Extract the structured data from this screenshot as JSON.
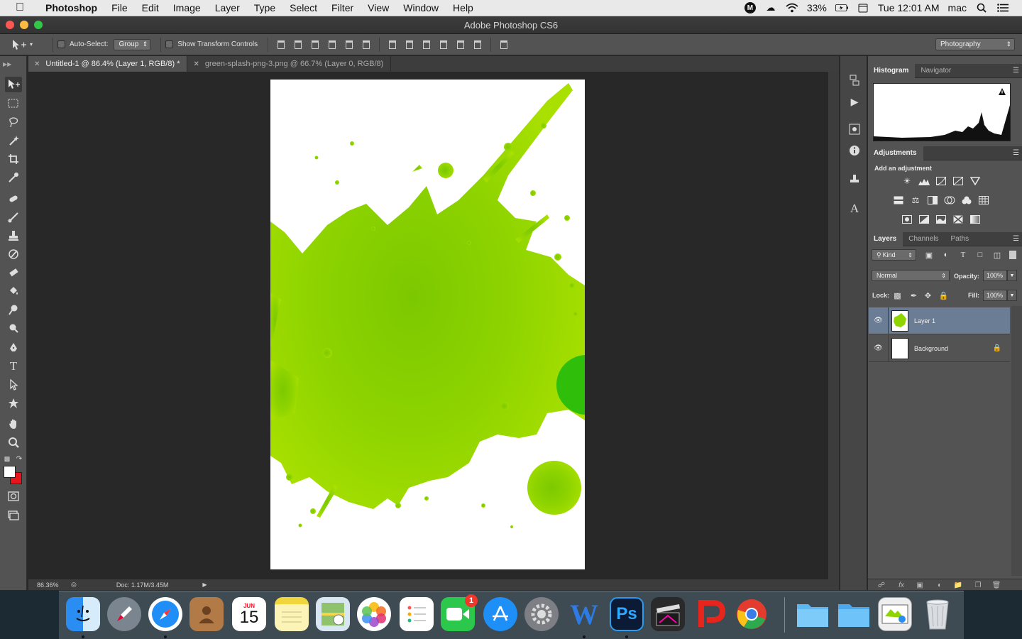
{
  "menubar": {
    "app_name": "Photoshop",
    "items": [
      "File",
      "Edit",
      "Image",
      "Layer",
      "Type",
      "Select",
      "Filter",
      "View",
      "Window",
      "Help"
    ],
    "status_m": "M",
    "battery": "33%",
    "clock": "Tue 12:01 AM",
    "user": "mac"
  },
  "window": {
    "title": "Adobe Photoshop CS6"
  },
  "options": {
    "auto_select_label": "Auto-Select:",
    "auto_select_value": "Group",
    "transform_label": "Show Transform Controls",
    "workspace": "Photography"
  },
  "tabs": [
    {
      "label": "Untitled-1 @ 86.4% (Layer 1, RGB/8) *"
    },
    {
      "label": "green-splash-png-3.png @ 66.7% (Layer 0, RGB/8)"
    }
  ],
  "status": {
    "zoom": "86.36%",
    "doc": "Doc: 1.17M/3.45M"
  },
  "panels": {
    "histogram_tabs": [
      "Histogram",
      "Navigator"
    ],
    "adjustments_tab": "Adjustments",
    "adjustments_title": "Add an adjustment",
    "layers_tabs": [
      "Layers",
      "Channels",
      "Paths"
    ],
    "kind": "Kind",
    "blend_mode": "Normal",
    "opacity_label": "Opacity:",
    "opacity": "100%",
    "lock_label": "Lock:",
    "fill_label": "Fill:",
    "fill": "100%",
    "layers": [
      {
        "name": "Layer 1"
      },
      {
        "name": "Background"
      }
    ]
  },
  "dock": {
    "calendar_month": "JUN",
    "calendar_day": "15",
    "facetime_badge": "1",
    "word_letter": "W",
    "photoshop_letters": "Ps"
  },
  "colors": {
    "foreground": "#ffffff",
    "background": "#e5141d",
    "splash": "#8fd400"
  }
}
